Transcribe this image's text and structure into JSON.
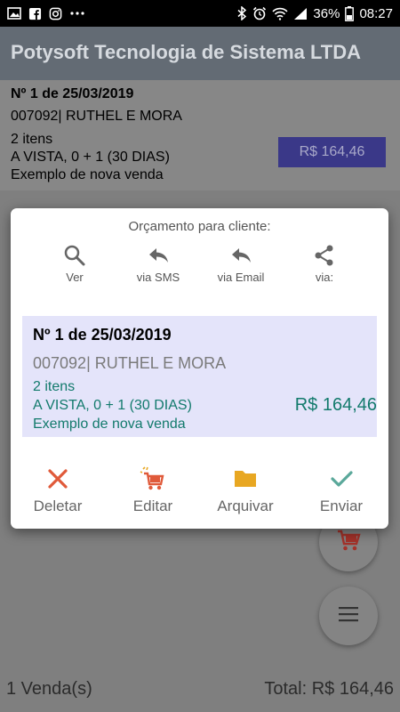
{
  "status_bar": {
    "battery": "36%",
    "time": "08:27",
    "icons": [
      "gallery-icon",
      "facebook-icon",
      "instagram-icon",
      "more-icon",
      "bluetooth-icon",
      "alarm-icon",
      "wifi-icon",
      "signal-icon",
      "battery-icon"
    ]
  },
  "app_bar": {
    "title": "Potysoft Tecnologia de Sistema LTDA"
  },
  "list_item": {
    "title": "Nº 1 de 25/03/2019",
    "client": "007092| RUTHEL E MORA",
    "items": "2 itens",
    "payment": "A VISTA, 0 + 1 (30 DIAS)",
    "note": "Exemplo de nova venda",
    "price": "R$ 164,46"
  },
  "dialog": {
    "title": "Orçamento para cliente:",
    "share_actions": [
      {
        "label": "Ver",
        "icon": "search-icon"
      },
      {
        "label": "via SMS",
        "icon": "reply-icon"
      },
      {
        "label": "via Email",
        "icon": "reply-icon"
      },
      {
        "label": "via:",
        "icon": "share-icon"
      }
    ],
    "preview": {
      "title": "Nº 1 de 25/03/2019",
      "client": "007092| RUTHEL E MORA",
      "items": "2 itens",
      "payment": "A VISTA, 0 + 1 (30 DIAS)",
      "note": "Exemplo de nova venda",
      "price": "R$ 164,46"
    },
    "actions": [
      {
        "label": "Deletar",
        "icon": "close-icon",
        "color": "#e05a3a"
      },
      {
        "label": "Editar",
        "icon": "cart-edit-icon",
        "color": "#e05a3a"
      },
      {
        "label": "Arquivar",
        "icon": "folder-icon",
        "color": "#e8a722"
      },
      {
        "label": "Enviar",
        "icon": "check-icon",
        "color": "#5aa89a"
      }
    ]
  },
  "footer": {
    "count": "1 Venda(s)",
    "total": "Total: R$ 164,46"
  },
  "colors": {
    "app_bar": "#636b74",
    "price_button": "#3a3888",
    "preview_bg": "#e4e4fa",
    "teal_text": "#127a6c",
    "overlay": "#7f7f7f"
  }
}
